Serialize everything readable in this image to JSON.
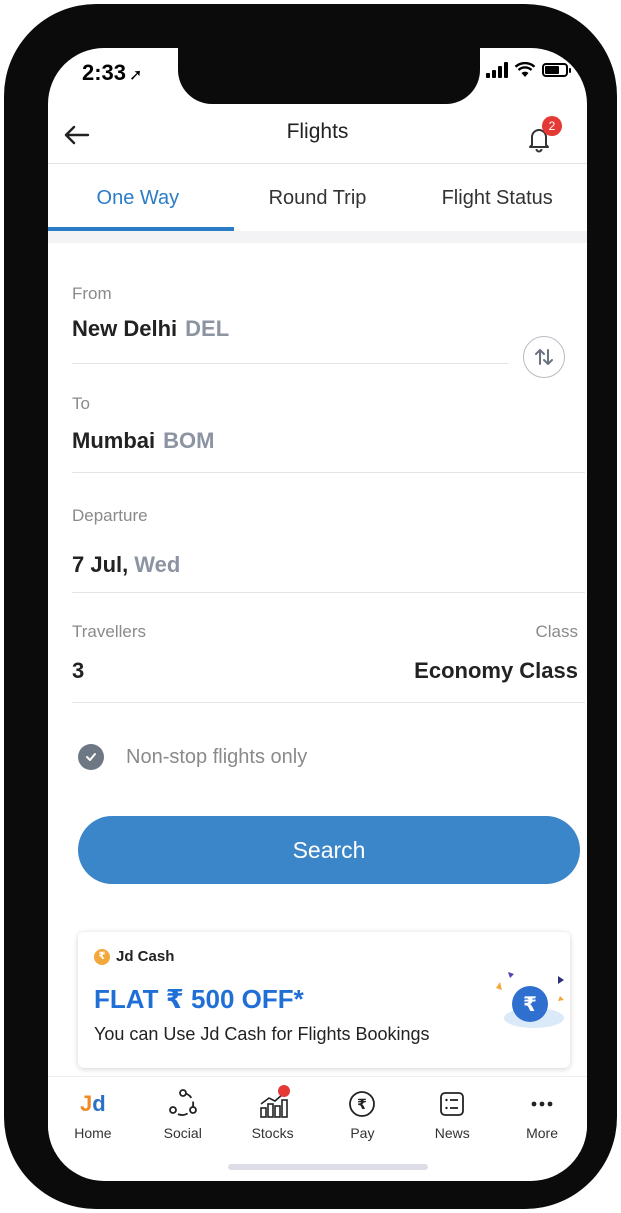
{
  "status_bar": {
    "time": "2:33"
  },
  "header": {
    "title": "Flights",
    "notification_count": "2"
  },
  "tabs": [
    {
      "label": "One Way",
      "active": true
    },
    {
      "label": "Round Trip",
      "active": false
    },
    {
      "label": "Flight Status",
      "active": false
    }
  ],
  "form": {
    "from": {
      "label": "From",
      "city": "New Delhi",
      "code": "DEL"
    },
    "to": {
      "label": "To",
      "city": "Mumbai",
      "code": "BOM"
    },
    "departure": {
      "label": "Departure",
      "date": "7 Jul,",
      "day": "Wed"
    },
    "travellers": {
      "label": "Travellers",
      "value": "3"
    },
    "class": {
      "label": "Class",
      "value": "Economy Class"
    },
    "non_stop": {
      "label": "Non-stop flights only",
      "checked": true
    },
    "search_label": "Search"
  },
  "promo": {
    "brand": "Jd Cash",
    "title": "FLAT ₹ 500 OFF*",
    "subtitle": "You can Use Jd Cash for Flights Bookings"
  },
  "bottom_nav": [
    {
      "label": "Home",
      "icon": "jd-logo-icon"
    },
    {
      "label": "Social",
      "icon": "social-icon"
    },
    {
      "label": "Stocks",
      "icon": "stocks-icon"
    },
    {
      "label": "Pay",
      "icon": "rupee-pay-icon"
    },
    {
      "label": "News",
      "icon": "news-icon"
    },
    {
      "label": "More",
      "icon": "more-dots-icon"
    }
  ],
  "colors": {
    "accent": "#2a7cc7",
    "button": "#3a86c8",
    "promo_title": "#1f6fd6",
    "badge": "#e53935"
  }
}
